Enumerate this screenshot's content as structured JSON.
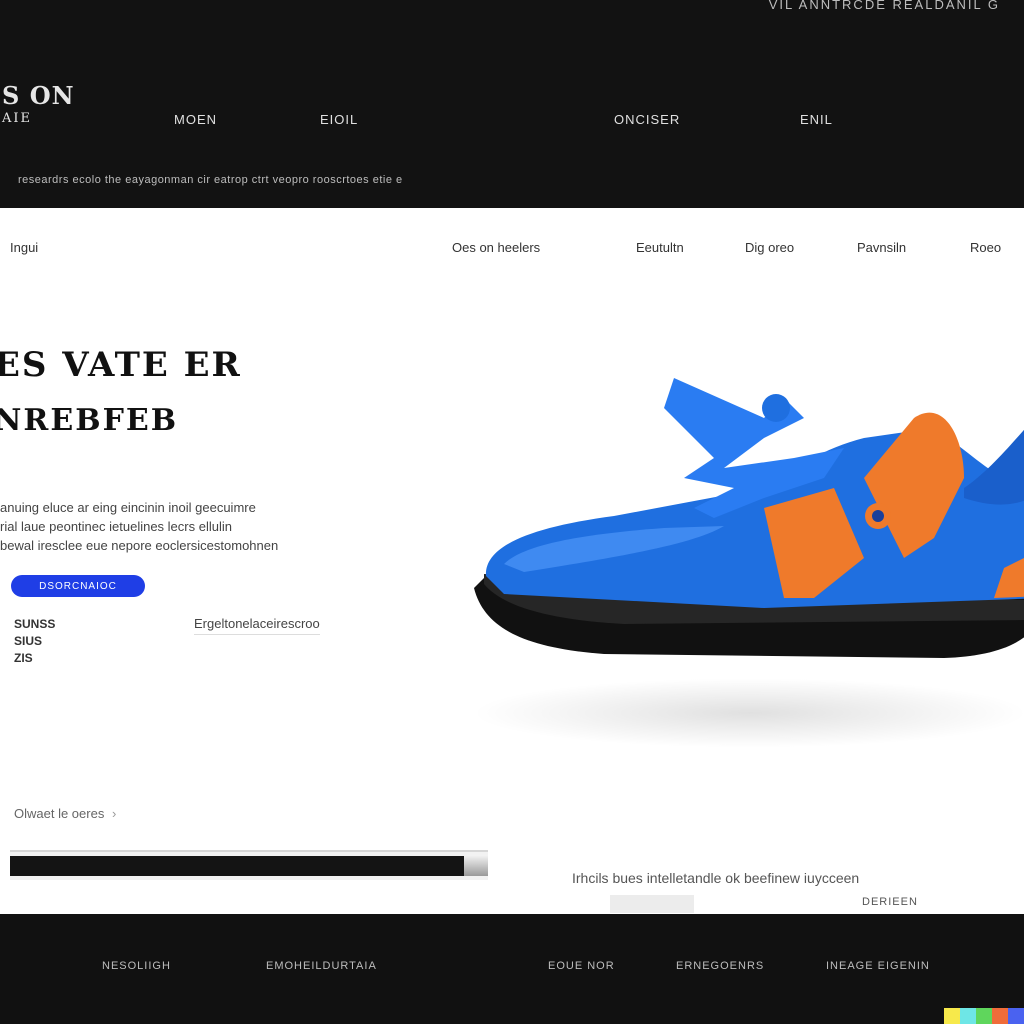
{
  "header": {
    "utility_text": "VIL ANNTRCDE REALDANIL G",
    "brand_top": "S ON",
    "brand_bottom": "AIE",
    "nav": [
      "MOEN",
      "EIOIL",
      "ONCISER",
      "ENIL"
    ],
    "tagline": "researdrs ecolo the eayagonman cir eatrop ctrt veopro rooscrtoes etie e"
  },
  "hero": {
    "sub_nav_left": "Ingui",
    "sub_nav": [
      "Oes on heelers",
      "Eeutultn",
      "Dig oreo",
      "Pavnsiln",
      "Roeo"
    ],
    "headline_1": "ES VATE ER",
    "headline_2": "NREBFEB",
    "description": [
      "anuing eluce ar eing eincinin inoil geecuimre",
      "rial laue peontinec ietuelines lecrs ellulin",
      "bewal iresclee eue nepore eoclersicestomohnen"
    ],
    "cta_label": "DSORCNAIOC",
    "stats": [
      "SUNSS",
      "SIUS",
      "ZIS"
    ],
    "secondary_link": "Ergeltonelaceirescroo",
    "scroll_label": "Olwaet le oeres",
    "progress": 0.95,
    "foot_note": "Irhcils bues intelletandle ok beefinew iuycceen",
    "foot_tag": "DERIEEN"
  },
  "footer": {
    "items": [
      "NESOLIIGH",
      "EMOHEILDURTAIA",
      "EOUE NOR",
      "ERNEGOENRS",
      "INEAGE EIGENIN"
    ]
  },
  "colors": {
    "accent": "#1f3ee6",
    "shoe_blue": "#1f6fe0",
    "shoe_orange": "#ef7a2b",
    "sole": "#111111"
  },
  "icons": {
    "scroll_chevron": "chevron-right-icon"
  }
}
